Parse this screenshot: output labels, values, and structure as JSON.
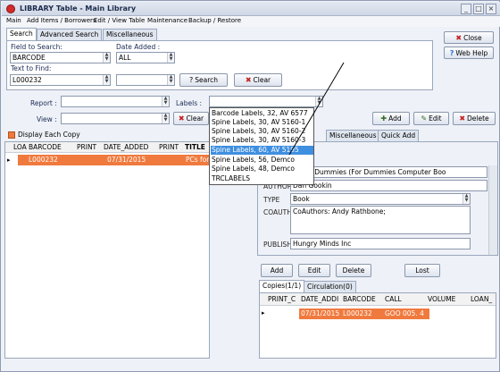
{
  "window": {
    "title": "LIBRARY Table - Main Library",
    "min": "_",
    "max": "□",
    "close": "×"
  },
  "menu": [
    "Main",
    "Add Items / Borrowers",
    "Edit / View Table",
    "Maintenance",
    "Backup / Restore"
  ],
  "search_tabs": [
    "Search",
    "Advanced Search",
    "Miscellaneous"
  ],
  "search": {
    "field_label": "Field to Search:",
    "field_value": "BARCODE",
    "date_label": "Date Added :",
    "date_value": "ALL",
    "text_label": "Text to Find:",
    "text_value": "L000232",
    "search_button": "Search",
    "clear_button": "Clear"
  },
  "side_buttons": {
    "close": "Close",
    "help": "Web Help"
  },
  "filters": {
    "report_label": "Report :",
    "labels_label": "Labels :",
    "view_label": "View :",
    "clear_button": "Clear"
  },
  "labels_dropdown": {
    "options": [
      "Barcode Labels, 32, AV 6577",
      "Spine Labels, 30, AV 5160-1",
      "Spine Labels, 30, AV 5160-2",
      "Spine Labels, 30, AV 5160-3",
      "Spine Labels, 60, AV 5195",
      "Spine Labels, 56, Demco",
      "Spine Labels, 48, Demco",
      "TRCLABELS"
    ],
    "selected_index": 4
  },
  "actions": {
    "add": "Add",
    "edit": "Edit",
    "delete": "Delete"
  },
  "display_each_copy": "Display Each Copy",
  "main_grid": {
    "columns": [
      "LOA",
      "BARCODE",
      "PRINT",
      "DATE_ADDED",
      "PRINT",
      "TITLE"
    ],
    "row": {
      "indicator": "▸",
      "barcode": "L000232",
      "date_added": "07/31/2015",
      "title": "PCs for"
    }
  },
  "detail_tabs": [
    "Miscellaneous",
    "Quick Add"
  ],
  "detail": {
    "title_value": "Cs for Dummies (For Dummies Computer Boo",
    "author_label": "AUTHOR",
    "author_value": "Dan Gookin",
    "type_label": "TYPE",
    "type_value": "Book",
    "coauthors_label": "COAUTHORS",
    "coauthors_value": "CoAuthors: Andy Rathbone;",
    "publisher_label": "PUBLISHER",
    "publisher_value": "Hungry Minds Inc"
  },
  "copy_buttons": {
    "add": "Add",
    "edit": "Edit",
    "delete": "Delete",
    "lost": "Lost"
  },
  "copy_tabs": [
    "Copies(1/1)",
    "Circulation(0)"
  ],
  "copies_grid": {
    "columns": [
      "PRINT_C",
      "DATE_ADDI",
      "BARCODE",
      "CALL",
      "VOLUME",
      "LOAN_"
    ],
    "row": {
      "indicator": "▸",
      "date_added": "07/31/2015",
      "barcode": "L000232",
      "call": "GOO 005. 4"
    }
  },
  "colors": {
    "selection": "#f07a3e",
    "dropdown_highlight": "#3f8fe0"
  }
}
